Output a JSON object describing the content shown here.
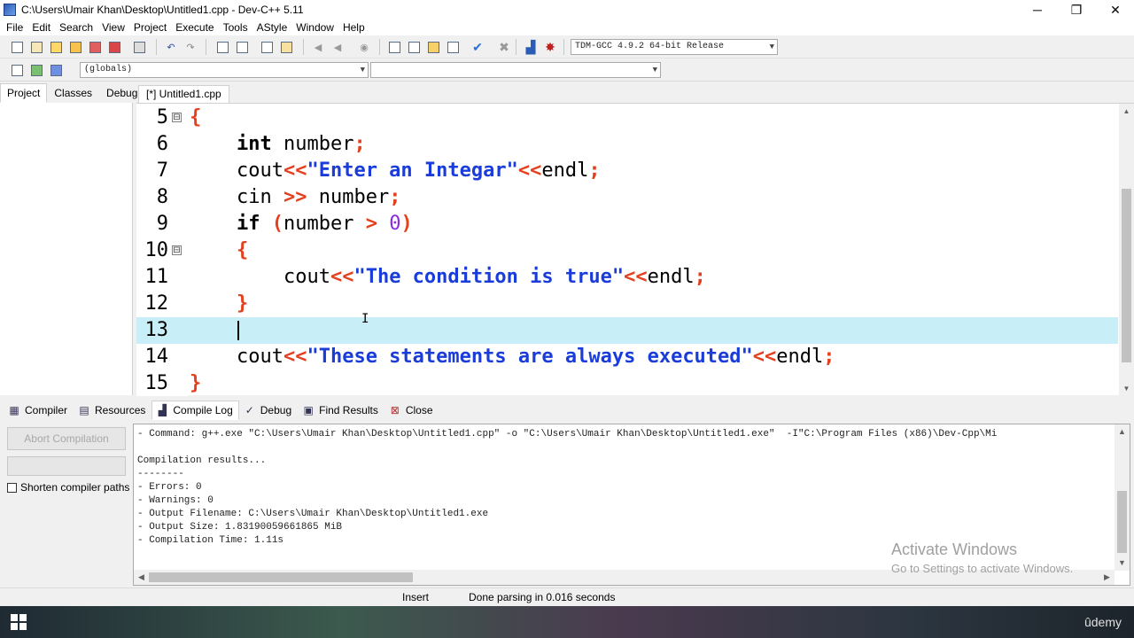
{
  "window": {
    "title": "C:\\Users\\Umair Khan\\Desktop\\Untitled1.cpp - Dev-C++ 5.11",
    "minimize": "─",
    "restore": "❐",
    "close": "✕"
  },
  "menu": [
    "File",
    "Edit",
    "Search",
    "View",
    "Project",
    "Execute",
    "Tools",
    "AStyle",
    "Window",
    "Help"
  ],
  "toolbar": {
    "compiler_select": "TDM-GCC 4.9.2 64-bit Release",
    "scope_select": "(globals)",
    "member_select": ""
  },
  "left_tabs": [
    "Project",
    "Classes",
    "Debug"
  ],
  "editor": {
    "tab_label": "[*] Untitled1.cpp",
    "lines": [
      {
        "n": "5",
        "fold": "⊟"
      },
      {
        "n": "6"
      },
      {
        "n": "7"
      },
      {
        "n": "8"
      },
      {
        "n": "9"
      },
      {
        "n": "10",
        "fold": "⊟"
      },
      {
        "n": "11"
      },
      {
        "n": "12"
      },
      {
        "n": "13"
      },
      {
        "n": "14"
      },
      {
        "n": "15"
      }
    ],
    "code": {
      "l5_brace": "{",
      "l6_kw": "int",
      "l6_rest": " number",
      "l6_semi": ";",
      "l7_cout": "cout",
      "l7_op": "<<",
      "l7_str": "\"Enter an Integar\"",
      "l7_op2": "<<",
      "l7_endl": "endl",
      "l7_semi": ";",
      "l8_cin": "cin ",
      "l8_op": ">>",
      "l8_rest": " number",
      "l8_semi": ";",
      "l9_kw": "if",
      "l9_sp": " ",
      "l9_paren": "(",
      "l9_var": "number ",
      "l9_op": ">",
      "l9_sp2": " ",
      "l9_num": "0",
      "l9_paren2": ")",
      "l10_brace": "{",
      "l11_cout": "cout",
      "l11_op": "<<",
      "l11_str": "\"The condition is true\"",
      "l11_op2": "<<",
      "l11_endl": "endl",
      "l11_semi": ";",
      "l12_brace": "}",
      "l14_cout": "cout",
      "l14_op": "<<",
      "l14_str": "\"These statements are always executed\"",
      "l14_op2": "<<",
      "l14_endl": "endl",
      "l14_semi": ";",
      "l15_brace": "}"
    }
  },
  "bottom_tabs": [
    {
      "label": "Compiler",
      "icon": "grid-icon"
    },
    {
      "label": "Resources",
      "icon": "resources-icon"
    },
    {
      "label": "Compile Log",
      "icon": "chart-icon"
    },
    {
      "label": "Debug",
      "icon": "check-icon"
    },
    {
      "label": "Find Results",
      "icon": "find-icon"
    },
    {
      "label": "Close",
      "icon": "close-icon"
    }
  ],
  "compile_panel": {
    "abort_label": "Abort Compilation",
    "shorten_label": "Shorten compiler paths",
    "log": [
      "- Command: g++.exe \"C:\\Users\\Umair Khan\\Desktop\\Untitled1.cpp\" -o \"C:\\Users\\Umair Khan\\Desktop\\Untitled1.exe\"  -I\"C:\\Program Files (x86)\\Dev-Cpp\\Mi",
      "",
      "Compilation results...",
      "--------",
      "- Errors: 0",
      "- Warnings: 0",
      "- Output Filename: C:\\Users\\Umair Khan\\Desktop\\Untitled1.exe",
      "- Output Size: 1.83190059661865 MiB",
      "- Compilation Time: 1.11s"
    ]
  },
  "watermark": {
    "line1": "Activate Windows",
    "line2": "Go to Settings to activate Windows."
  },
  "status": {
    "mode": "Insert",
    "message": "Done parsing in 0.016 seconds"
  },
  "taskbar": {
    "brand": "ûdemy"
  }
}
